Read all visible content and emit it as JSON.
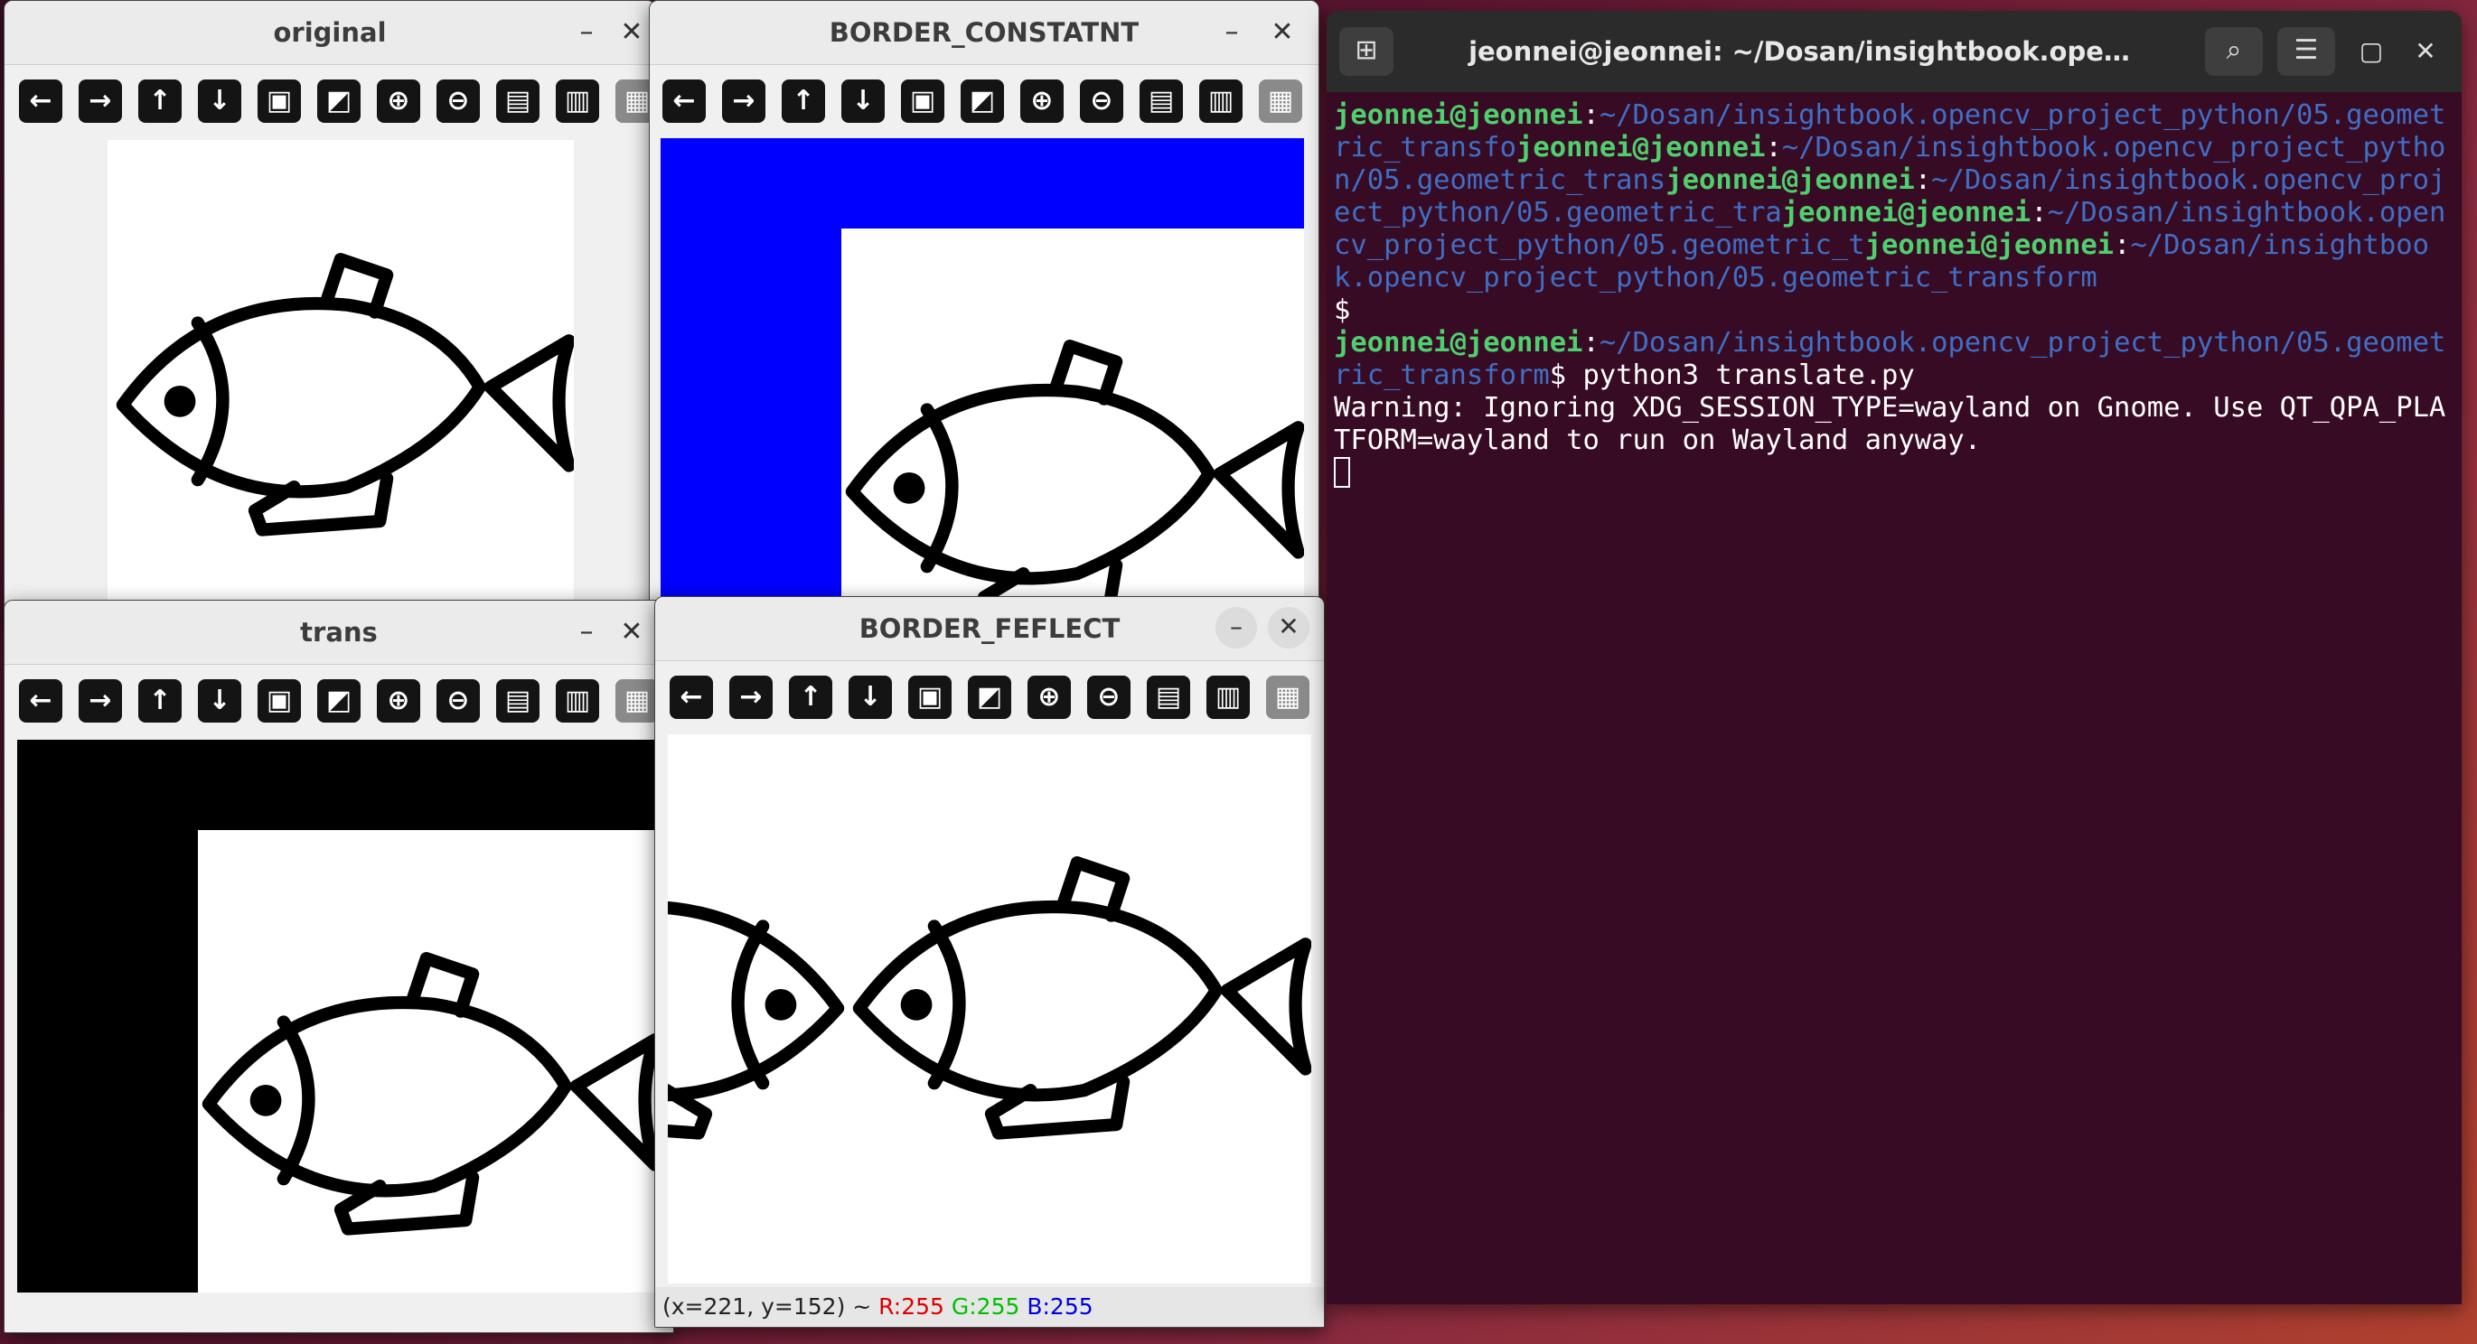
{
  "windows": {
    "original": {
      "title": "original",
      "minimize": "–",
      "close": "✕"
    },
    "border_constant": {
      "title": "BORDER_CONSTATNT",
      "minimize": "–",
      "close": "✕"
    },
    "trans": {
      "title": "trans",
      "minimize": "–",
      "close": "✕"
    },
    "border_reflect": {
      "title": "BORDER_FEFLECT",
      "minimize": "–",
      "close": "✕",
      "status": {
        "coords": "(x=221, y=152) ~ ",
        "r": "R:255",
        "g": "G:255",
        "b": "B:255"
      }
    }
  },
  "toolbar_icons": [
    "arrow-left",
    "arrow-right",
    "arrow-up",
    "arrow-down",
    "image",
    "image-edit",
    "zoom-in",
    "zoom-out",
    "save",
    "clipboard",
    "settings"
  ],
  "toolbar_glyphs": {
    "left": "←",
    "right": "→",
    "up": "↑",
    "down": "↓",
    "image": "▣",
    "image_edit": "◩",
    "zoom_in": "⊕",
    "zoom_out": "⊖",
    "save": "▤",
    "clipboard": "▥",
    "settings": "▦"
  },
  "colors": {
    "constant_border": "#0000ff",
    "trans_fill": "#000000",
    "terminal_bg": "#380b25",
    "prompt_user": "#4fd06e",
    "prompt_path": "#3f6fc5"
  },
  "terminal": {
    "title": "jeonnei@jeonnei: ~/Dosan/insightbook.ope…",
    "new_tab": "⊞",
    "search": "⌕",
    "menu": "☰",
    "min": "–",
    "max": "▢",
    "close": "✕",
    "user": "jeonnei@jeonnei",
    "colon": ":",
    "frag1": "~/Dosan/insightbook.opencv_project_python/05.geometric_transfo",
    "frag2": "~/Dosan/insightbook.opencv_project_python/05.geometric_trans",
    "frag3": "~/Dosan/insightbook.opencv_project_python/05.geometric_tra",
    "frag4": "~/Dosan/insightbook.opencv_project_python/05.geometric_t",
    "frag5": "~/Dosan/insightbook.opencv_project_python/05.geometric_transform",
    "dollar_line": "$",
    "cmd_path": "~/Dosan/insightbook.opencv_project_python/05.geometric_transform",
    "cmd": "$ python3 translate.py",
    "warning": "Warning: Ignoring XDG_SESSION_TYPE=wayland on Gnome. Use QT_QPA_PLATFORM=wayland to run on Wayland anyway."
  }
}
